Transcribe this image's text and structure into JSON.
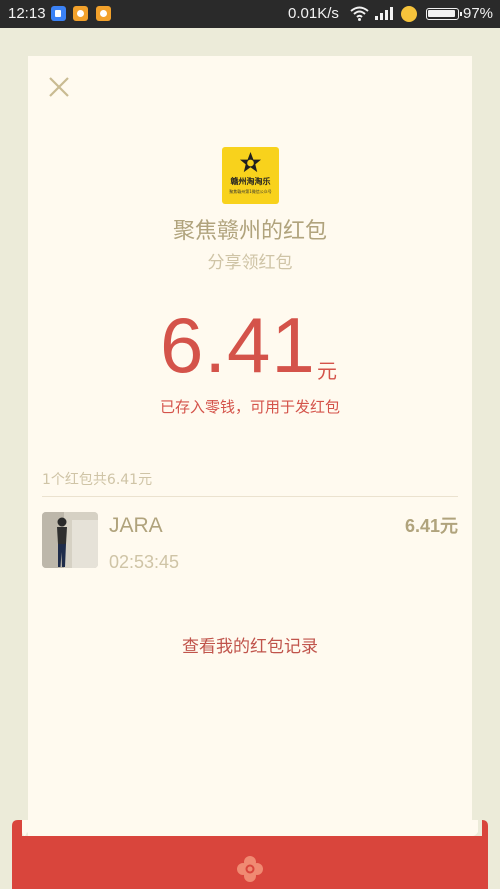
{
  "status_bar": {
    "time": "12:13",
    "network_speed": "0.01K/s",
    "battery": "97%",
    "icons": [
      "app-icon",
      "app-icon",
      "app-icon",
      "wifi-icon",
      "signal-icon",
      "emoji-icon",
      "battery-icon"
    ]
  },
  "close": {
    "icon": "close-icon"
  },
  "sender": {
    "logo_text": "赣州淘淘乐",
    "logo_sub": "聚焦赣州第1微信公众号",
    "title": "聚焦赣州的红包",
    "greeting": "分享领红包"
  },
  "amount": {
    "value": "6.41",
    "unit": "元"
  },
  "note": "已存入零钱，可用于发红包",
  "summary": "1个红包共6.41元",
  "receivers": [
    {
      "name": "JARA",
      "time": "02:53:45",
      "amount": "6.41元"
    }
  ],
  "history_link": "查看我的红包记录",
  "colors": {
    "background": "#ecebd9",
    "card": "#fffaef",
    "accent_red": "#d4534a",
    "gold_text": "#b0a37c",
    "muted_text": "#cfc4a6",
    "logo_yellow": "#f8d21c",
    "band_red": "#d9453c"
  }
}
